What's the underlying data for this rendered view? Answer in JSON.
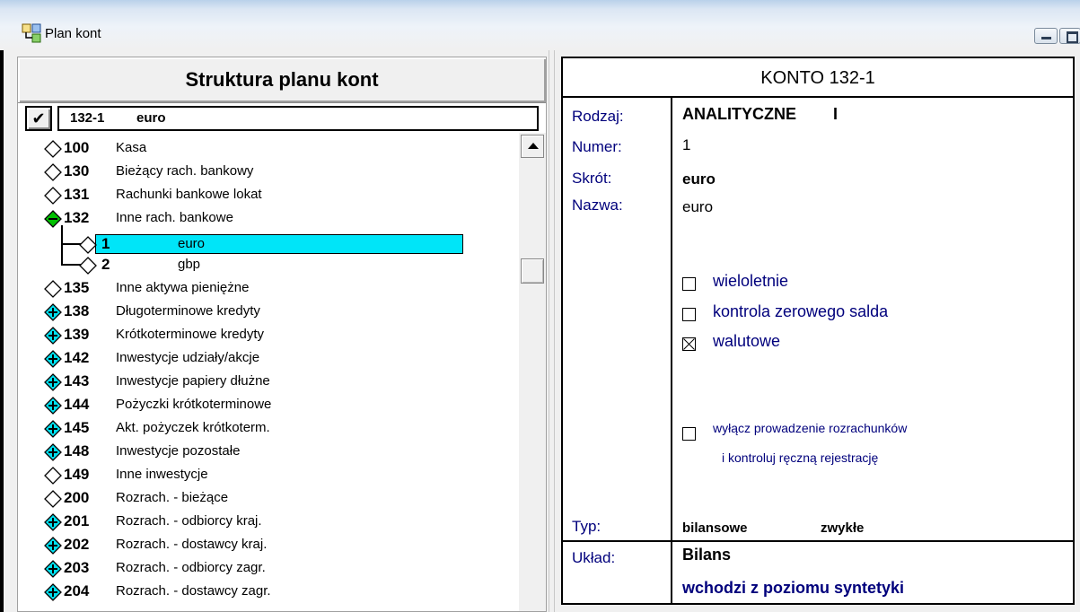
{
  "window": {
    "title": "Plan kont",
    "icon": "accounts-tree-icon",
    "minimize_icon": "minimize-icon",
    "maximize_icon": "maximize-icon"
  },
  "left_panel": {
    "header": "Struktura planu kont",
    "check_button_symbol": "✔",
    "selected": {
      "number": "132-1",
      "name": "euro"
    },
    "tree": [
      {
        "number": "100",
        "name": "Kasa",
        "icon": "diamond-empty"
      },
      {
        "number": "130",
        "name": "Bieżący rach. bankowy",
        "icon": "diamond-empty"
      },
      {
        "number": "131",
        "name": "Rachunki bankowe lokat",
        "icon": "diamond-empty"
      },
      {
        "number": "132",
        "name": "Inne rach. bankowe",
        "icon": "diamond-minus-green",
        "children": [
          {
            "number": "1",
            "name": "euro",
            "selected": true
          },
          {
            "number": "2",
            "name": "gbp",
            "selected": false
          }
        ]
      },
      {
        "number": "135",
        "name": "Inne aktywa pieniężne",
        "icon": "diamond-empty"
      },
      {
        "number": "138",
        "name": "Długoterminowe kredyty",
        "icon": "diamond-plus-cyan"
      },
      {
        "number": "139",
        "name": "Krótkoterminowe kredyty",
        "icon": "diamond-plus-cyan"
      },
      {
        "number": "142",
        "name": "Inwestycje udziały/akcje",
        "icon": "diamond-plus-cyan"
      },
      {
        "number": "143",
        "name": "Inwestycje papiery dłużne",
        "icon": "diamond-plus-cyan"
      },
      {
        "number": "144",
        "name": "Pożyczki krótkoterminowe",
        "icon": "diamond-plus-cyan"
      },
      {
        "number": "145",
        "name": "Akt. pożyczek krótkoterm.",
        "icon": "diamond-plus-cyan"
      },
      {
        "number": "148",
        "name": "Inwestycje pozostałe",
        "icon": "diamond-plus-cyan"
      },
      {
        "number": "149",
        "name": "Inne inwestycje",
        "icon": "diamond-empty"
      },
      {
        "number": "200",
        "name": "Rozrach. - bieżące",
        "icon": "diamond-empty"
      },
      {
        "number": "201",
        "name": "Rozrach. - odbiorcy kraj.",
        "icon": "diamond-plus-cyan"
      },
      {
        "number": "202",
        "name": "Rozrach. - dostawcy kraj.",
        "icon": "diamond-plus-cyan"
      },
      {
        "number": "203",
        "name": "Rozrach. - odbiorcy zagr.",
        "icon": "diamond-plus-cyan"
      },
      {
        "number": "204",
        "name": "Rozrach. - dostawcy zagr.",
        "icon": "diamond-plus-cyan"
      }
    ]
  },
  "right_panel": {
    "title": "KONTO  132-1",
    "labels": {
      "rodzaj": "Rodzaj:",
      "numer": "Numer:",
      "skrot": "Skrót:",
      "nazwa": "Nazwa:",
      "typ": "Typ:",
      "uklad": "Układ:"
    },
    "values": {
      "rodzaj": "ANALITYCZNE",
      "rodzaj_level": "I",
      "numer": "1",
      "skrot": "euro",
      "nazwa": "euro",
      "typ_1": "bilansowe",
      "typ_2": "zwykłe",
      "uklad": "Bilans",
      "uklad_note": "wchodzi z poziomu syntetyki"
    },
    "checkboxes": [
      {
        "label": "wieloletnie",
        "checked": false
      },
      {
        "label": "kontrola zerowego salda",
        "checked": false
      },
      {
        "label": "walutowe",
        "checked": true
      }
    ],
    "exclusion": {
      "line1": "wyłącz prowadzenie rozrachunków",
      "line2": "i kontroluj ręczną rejestrację",
      "checked": false
    }
  },
  "colors": {
    "label_blue": "#00007c",
    "highlight": "#00e5f8",
    "minus_green": "#00c000",
    "plus_cyan": "#00e0f0"
  }
}
